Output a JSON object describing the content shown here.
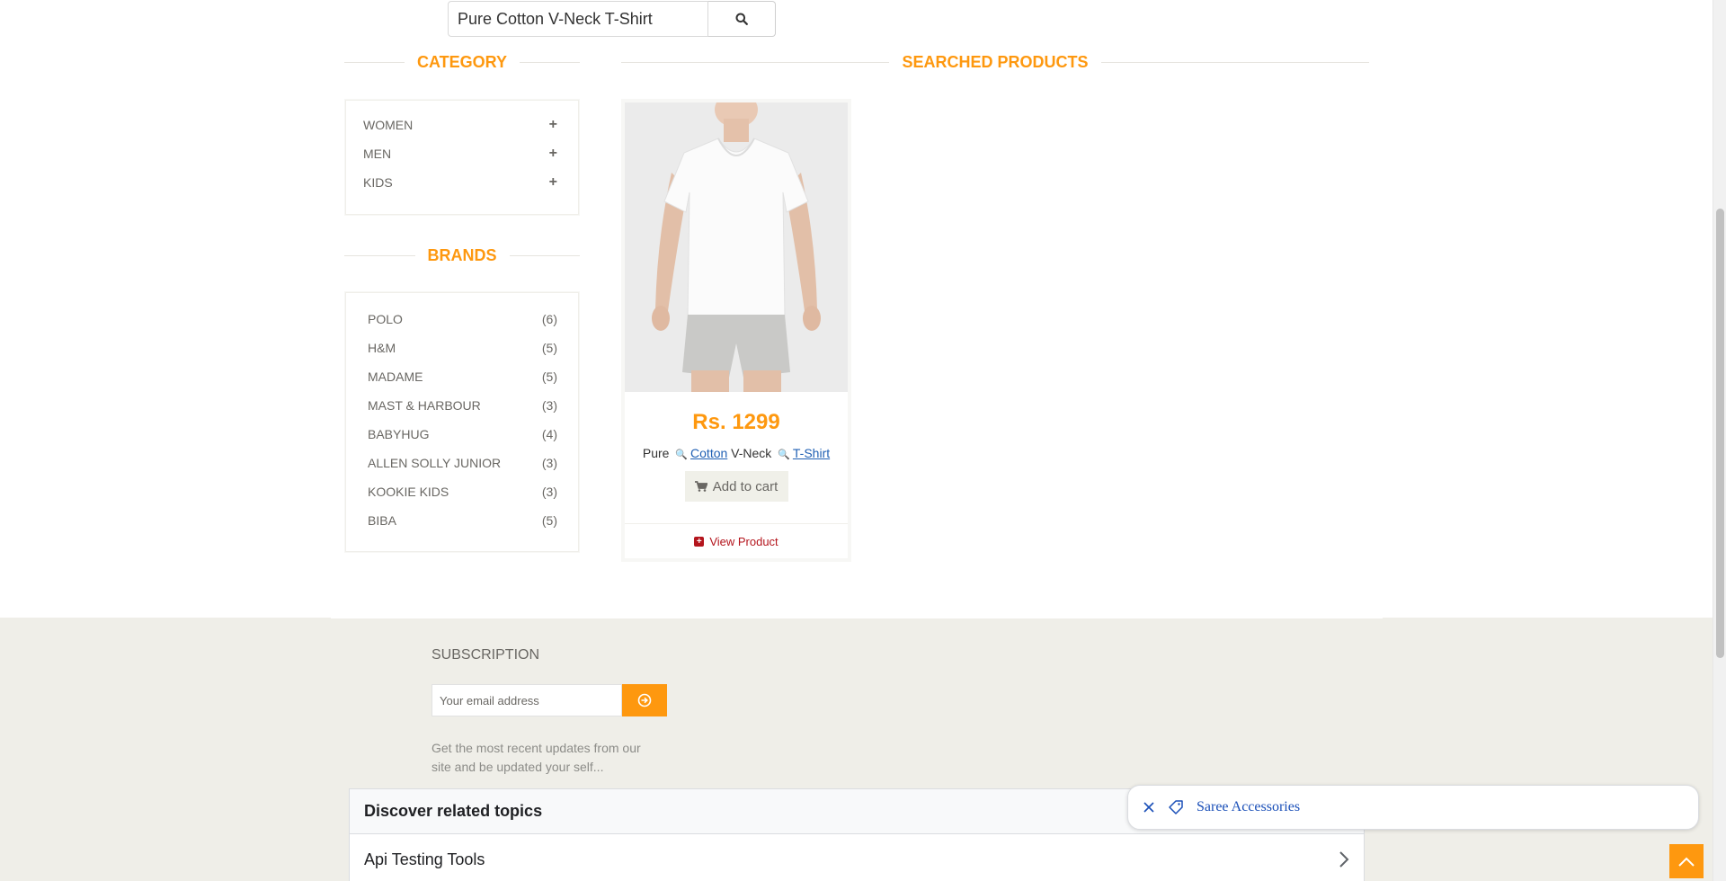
{
  "search": {
    "value": "Pure Cotton V-Neck T-Shirt"
  },
  "category": {
    "title": "Category",
    "items": [
      {
        "label": "WOMEN",
        "icon": "plus-icon"
      },
      {
        "label": "MEN",
        "icon": "plus-icon"
      },
      {
        "label": "KIDS",
        "icon": "plus-icon"
      }
    ]
  },
  "brands": {
    "title": "Brands",
    "items": [
      {
        "name": "POLO",
        "count": "(6)"
      },
      {
        "name": "H&M",
        "count": "(5)"
      },
      {
        "name": "MADAME",
        "count": "(5)"
      },
      {
        "name": "MAST & HARBOUR",
        "count": "(3)"
      },
      {
        "name": "BABYHUG",
        "count": "(4)"
      },
      {
        "name": "ALLEN SOLLY JUNIOR",
        "count": "(3)"
      },
      {
        "name": "KOOKIE KIDS",
        "count": "(3)"
      },
      {
        "name": "BIBA",
        "count": "(5)"
      }
    ]
  },
  "results": {
    "title": "Searched Products",
    "product": {
      "price": "Rs. 1299",
      "name_parts": {
        "w1": "Pure",
        "link1": "Cotton",
        "w2": "V-Neck",
        "link2": "T-Shirt"
      },
      "add_to_cart": "Add to cart",
      "view_product": "View Product"
    }
  },
  "footer": {
    "subscription_title": "SUBSCRIPTION",
    "email_placeholder": "Your email address",
    "description": "Get the most recent updates from our site and be updated your self..."
  },
  "related_topics": {
    "heading": "Discover related topics",
    "items": [
      "Api Testing Tools"
    ]
  },
  "chip": {
    "label": "Saree Accessories"
  },
  "colors": {
    "accent": "#FE980F",
    "footer_bg": "#EFEEE8",
    "link": "#2060b4"
  }
}
